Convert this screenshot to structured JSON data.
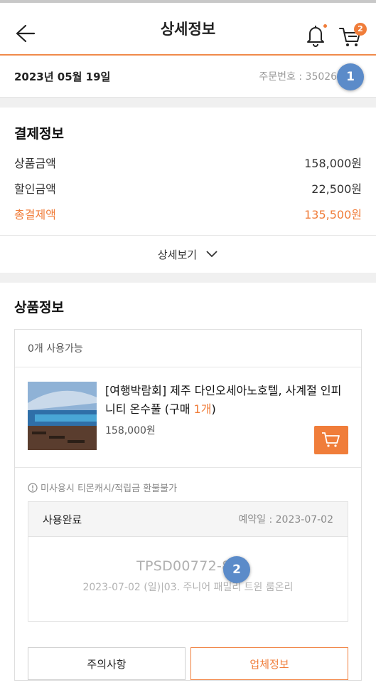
{
  "header": {
    "title": "상세정보",
    "cart_count": "2"
  },
  "order": {
    "date": "2023년 05월 19일",
    "order_number": "주문번호 : 350261"
  },
  "markers": [
    "1",
    "2"
  ],
  "payment": {
    "title": "결제정보",
    "rows": [
      {
        "label": "상품금액",
        "value": "158,000원"
      },
      {
        "label": "할인금액",
        "value": "22,500원"
      },
      {
        "label": "총결제액",
        "value": "135,500원"
      }
    ],
    "more_label": "상세보기"
  },
  "product_info": {
    "title": "상품정보",
    "usable_count": "0개 사용가능",
    "product_name": "[여행박람회] 제주 다인오세아노호텔, 사계절 인피니티 온수풀 (구매 ",
    "product_qty": "1개",
    "product_name_end": ")",
    "product_price": "158,000원",
    "notice": "미사용시 티몬캐시/적립금 환불불가",
    "status": "사용완료",
    "reservation": "예약일 : 2023-07-02",
    "ticket_code": "TPSD00772-80",
    "ticket_detail": "2023-07-02 (일)|03. 주니어 패밀리 트윈 룸온리",
    "button_caution": "주의사항",
    "button_vendor": "업체정보"
  },
  "colors": {
    "accent": "#f07d3a",
    "marker": "#5b8bc9"
  }
}
